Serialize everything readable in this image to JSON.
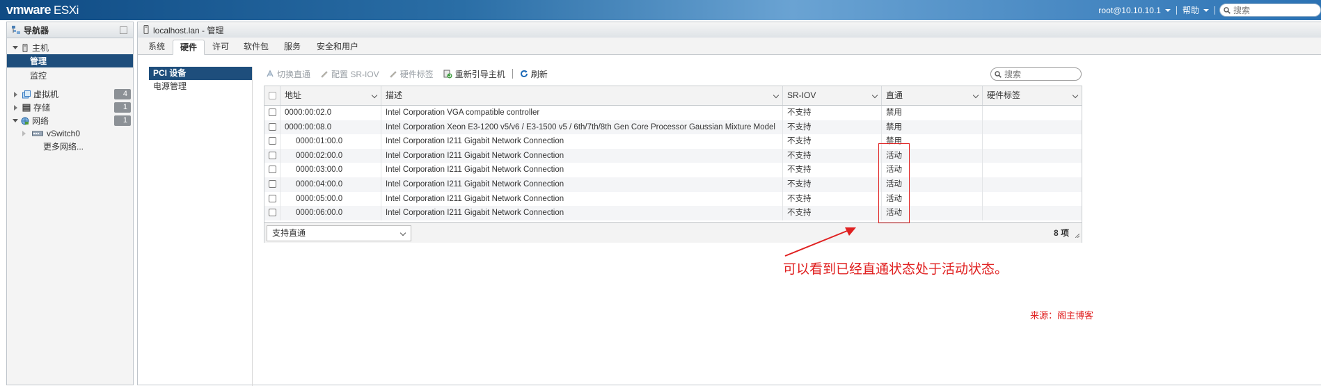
{
  "topbar": {
    "brand": "vmware",
    "product": "ESXi",
    "user": "root@10.10.10.1",
    "help": "帮助",
    "search_placeholder": "搜索"
  },
  "navigator": {
    "title": "导航器",
    "items": [
      {
        "label": "主机"
      },
      {
        "label": "管理"
      },
      {
        "label": "监控"
      },
      {
        "label": "虚拟机",
        "count": "4"
      },
      {
        "label": "存储",
        "count": "1"
      },
      {
        "label": "网络",
        "count": "1"
      },
      {
        "label": "vSwitch0"
      },
      {
        "label": "更多网络..."
      }
    ]
  },
  "main": {
    "title": "localhost.lan - 管理",
    "tabs": [
      "系统",
      "硬件",
      "许可",
      "软件包",
      "服务",
      "安全和用户"
    ],
    "subnav": [
      "PCI 设备",
      "电源管理"
    ],
    "toolbar": {
      "toggle": "切换直通",
      "sriov": "配置 SR-IOV",
      "hwlabel": "硬件标签",
      "reboot": "重新引导主机",
      "refresh": "刷新"
    },
    "search_placeholder": "搜索"
  },
  "grid": {
    "columns": [
      "地址",
      "描述",
      "SR-IOV",
      "直通",
      "硬件标签"
    ],
    "rows": [
      {
        "address": "0000:00:02.0",
        "desc": "Intel Corporation VGA compatible controller",
        "sriov": "不支持",
        "passthru": "禁用",
        "label": ""
      },
      {
        "address": "0000:00:08.0",
        "desc": "Intel Corporation Xeon E3-1200 v5/v6 / E3-1500 v5 / 6th/7th/8th Gen Core Processor Gaussian Mixture Model",
        "sriov": "不支持",
        "passthru": "禁用",
        "label": ""
      },
      {
        "address": "0000:01:00.0",
        "desc": "Intel Corporation I211 Gigabit Network Connection",
        "sriov": "不支持",
        "passthru": "禁用",
        "label": ""
      },
      {
        "address": "0000:02:00.0",
        "desc": "Intel Corporation I211 Gigabit Network Connection",
        "sriov": "不支持",
        "passthru": "活动",
        "label": ""
      },
      {
        "address": "0000:03:00.0",
        "desc": "Intel Corporation I211 Gigabit Network Connection",
        "sriov": "不支持",
        "passthru": "活动",
        "label": ""
      },
      {
        "address": "0000:04:00.0",
        "desc": "Intel Corporation I211 Gigabit Network Connection",
        "sriov": "不支持",
        "passthru": "活动",
        "label": ""
      },
      {
        "address": "0000:05:00.0",
        "desc": "Intel Corporation I211 Gigabit Network Connection",
        "sriov": "不支持",
        "passthru": "活动",
        "label": ""
      },
      {
        "address": "0000:06:00.0",
        "desc": "Intel Corporation I211 Gigabit Network Connection",
        "sriov": "不支持",
        "passthru": "活动",
        "label": ""
      }
    ],
    "filter": "支持直通",
    "count": "8 项"
  },
  "annotation": {
    "text": "可以看到已经直通状态处于活动状态。",
    "color": "#e02020"
  },
  "watermark": "来源：阁主博客",
  "colors": {
    "accent": "#1e4e7c",
    "topbar": "#2a6ea6"
  }
}
